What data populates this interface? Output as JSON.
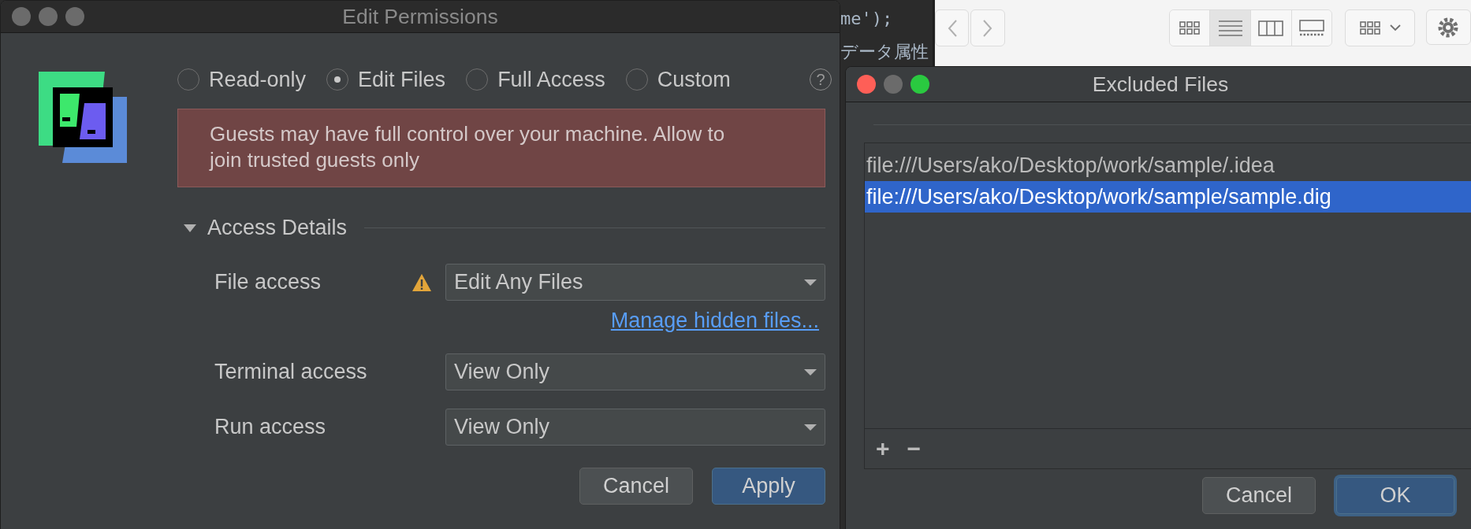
{
  "permissions_dialog": {
    "title": "Edit Permissions",
    "active": false,
    "modes": [
      {
        "label": "Read-only",
        "selected": false
      },
      {
        "label": "Edit Files",
        "selected": true
      },
      {
        "label": "Full Access",
        "selected": false
      },
      {
        "label": "Custom",
        "selected": false
      }
    ],
    "help": "?",
    "warning": "Guests may have full control over your machine. Allow to join trusted guests only",
    "section": {
      "label": "Access Details",
      "expanded": true
    },
    "fields": [
      {
        "label": "File access",
        "value": "Edit Any Files",
        "warning": true
      },
      {
        "label": "Terminal access",
        "value": "View Only",
        "warning": false
      },
      {
        "label": "Run access",
        "value": "View Only",
        "warning": false
      }
    ],
    "link": "Manage hidden files...",
    "buttons": [
      {
        "label": "Cancel",
        "primary": false
      },
      {
        "label": "Apply",
        "primary": true
      }
    ]
  },
  "editor": {
    "lines": [
      "me');",
      "データ属性"
    ]
  },
  "finder_toolbar": {
    "view_buttons": [
      {
        "kind": "icons",
        "selected": false
      },
      {
        "kind": "list",
        "selected": true
      },
      {
        "kind": "columns",
        "selected": false
      },
      {
        "kind": "gallery",
        "selected": false
      }
    ]
  },
  "excluded_dialog": {
    "title": "Excluded Files",
    "active": true,
    "files": [
      {
        "path": "file:///Users/ako/Desktop/work/sample/.idea",
        "selected": false
      },
      {
        "path": "file:///Users/ako/Desktop/work/sample/sample.dig",
        "selected": true
      }
    ],
    "toolbar": [
      "+",
      "−"
    ],
    "buttons": [
      {
        "label": "Cancel",
        "primary": false
      },
      {
        "label": "OK",
        "primary": true
      }
    ]
  }
}
